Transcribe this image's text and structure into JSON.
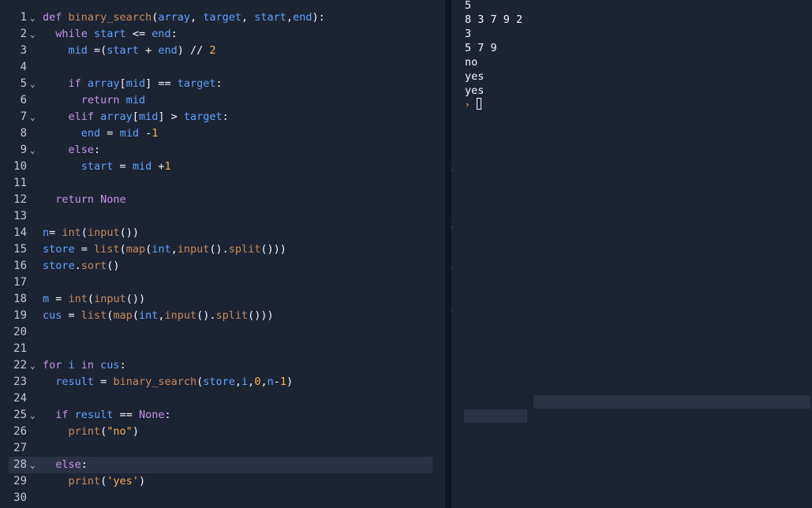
{
  "editor": {
    "active_line": 28,
    "lines": [
      {
        "n": "1",
        "fold": true,
        "tokens": [
          [
            "kw",
            "def "
          ],
          [
            "fn",
            "binary_search"
          ],
          [
            "op",
            "("
          ],
          [
            "var",
            "array"
          ],
          [
            "op",
            ", "
          ],
          [
            "var",
            "target"
          ],
          [
            "op",
            ", "
          ],
          [
            "var",
            "start"
          ],
          [
            "op",
            ","
          ],
          [
            "var",
            "end"
          ],
          [
            "op",
            "):"
          ]
        ]
      },
      {
        "n": "2",
        "fold": true,
        "tokens": [
          [
            "op",
            "  "
          ],
          [
            "kw",
            "while "
          ],
          [
            "var",
            "start"
          ],
          [
            "op",
            " <= "
          ],
          [
            "var",
            "end"
          ],
          [
            "op",
            ":"
          ]
        ]
      },
      {
        "n": "3",
        "fold": false,
        "tokens": [
          [
            "op",
            "    "
          ],
          [
            "var",
            "mid"
          ],
          [
            "op",
            " =("
          ],
          [
            "var",
            "start"
          ],
          [
            "op",
            " + "
          ],
          [
            "var",
            "end"
          ],
          [
            "op",
            ") // "
          ],
          [
            "num",
            "2"
          ]
        ]
      },
      {
        "n": "4",
        "fold": false,
        "tokens": []
      },
      {
        "n": "5",
        "fold": true,
        "tokens": [
          [
            "op",
            "    "
          ],
          [
            "kw",
            "if "
          ],
          [
            "var",
            "array"
          ],
          [
            "op",
            "["
          ],
          [
            "var",
            "mid"
          ],
          [
            "op",
            "] == "
          ],
          [
            "var",
            "target"
          ],
          [
            "op",
            ":"
          ]
        ]
      },
      {
        "n": "6",
        "fold": false,
        "tokens": [
          [
            "op",
            "      "
          ],
          [
            "kw",
            "return "
          ],
          [
            "var",
            "mid"
          ]
        ]
      },
      {
        "n": "7",
        "fold": true,
        "tokens": [
          [
            "op",
            "    "
          ],
          [
            "kw",
            "elif "
          ],
          [
            "var",
            "array"
          ],
          [
            "op",
            "["
          ],
          [
            "var",
            "mid"
          ],
          [
            "op",
            "] > "
          ],
          [
            "var",
            "target"
          ],
          [
            "op",
            ":"
          ]
        ]
      },
      {
        "n": "8",
        "fold": false,
        "tokens": [
          [
            "op",
            "      "
          ],
          [
            "var",
            "end"
          ],
          [
            "op",
            " = "
          ],
          [
            "var",
            "mid"
          ],
          [
            "op",
            " -"
          ],
          [
            "num",
            "1"
          ]
        ]
      },
      {
        "n": "9",
        "fold": true,
        "tokens": [
          [
            "op",
            "    "
          ],
          [
            "kw",
            "else"
          ],
          [
            "op",
            ":"
          ]
        ]
      },
      {
        "n": "10",
        "fold": false,
        "tokens": [
          [
            "op",
            "      "
          ],
          [
            "var",
            "start"
          ],
          [
            "op",
            " = "
          ],
          [
            "var",
            "mid"
          ],
          [
            "op",
            " +"
          ],
          [
            "num",
            "1"
          ]
        ]
      },
      {
        "n": "11",
        "fold": false,
        "tokens": []
      },
      {
        "n": "12",
        "fold": false,
        "tokens": [
          [
            "op",
            "  "
          ],
          [
            "kw",
            "return "
          ],
          [
            "kw",
            "None"
          ]
        ]
      },
      {
        "n": "13",
        "fold": false,
        "tokens": []
      },
      {
        "n": "14",
        "fold": false,
        "tokens": [
          [
            "var",
            "n"
          ],
          [
            "op",
            "= "
          ],
          [
            "fn",
            "int"
          ],
          [
            "op",
            "("
          ],
          [
            "fn",
            "input"
          ],
          [
            "op",
            "())"
          ]
        ]
      },
      {
        "n": "15",
        "fold": false,
        "tokens": [
          [
            "var",
            "store"
          ],
          [
            "op",
            " = "
          ],
          [
            "fn",
            "list"
          ],
          [
            "op",
            "("
          ],
          [
            "fn",
            "map"
          ],
          [
            "op",
            "("
          ],
          [
            "var",
            "int"
          ],
          [
            "op",
            ","
          ],
          [
            "fn",
            "input"
          ],
          [
            "op",
            "()."
          ],
          [
            "fn",
            "split"
          ],
          [
            "op",
            "()))"
          ]
        ]
      },
      {
        "n": "16",
        "fold": false,
        "tokens": [
          [
            "var",
            "store"
          ],
          [
            "op",
            "."
          ],
          [
            "fn",
            "sort"
          ],
          [
            "op",
            "()"
          ]
        ]
      },
      {
        "n": "17",
        "fold": false,
        "tokens": []
      },
      {
        "n": "18",
        "fold": false,
        "tokens": [
          [
            "var",
            "m"
          ],
          [
            "op",
            " = "
          ],
          [
            "fn",
            "int"
          ],
          [
            "op",
            "("
          ],
          [
            "fn",
            "input"
          ],
          [
            "op",
            "())"
          ]
        ]
      },
      {
        "n": "19",
        "fold": false,
        "tokens": [
          [
            "var",
            "cus"
          ],
          [
            "op",
            " = "
          ],
          [
            "fn",
            "list"
          ],
          [
            "op",
            "("
          ],
          [
            "fn",
            "map"
          ],
          [
            "op",
            "("
          ],
          [
            "var",
            "int"
          ],
          [
            "op",
            ","
          ],
          [
            "fn",
            "input"
          ],
          [
            "op",
            "()."
          ],
          [
            "fn",
            "split"
          ],
          [
            "op",
            "()))"
          ]
        ]
      },
      {
        "n": "20",
        "fold": false,
        "tokens": []
      },
      {
        "n": "21",
        "fold": false,
        "tokens": []
      },
      {
        "n": "22",
        "fold": true,
        "tokens": [
          [
            "kw",
            "for "
          ],
          [
            "var",
            "i"
          ],
          [
            "kw",
            " in "
          ],
          [
            "var",
            "cus"
          ],
          [
            "op",
            ":"
          ]
        ]
      },
      {
        "n": "23",
        "fold": false,
        "tokens": [
          [
            "op",
            "  "
          ],
          [
            "var",
            "result"
          ],
          [
            "op",
            " = "
          ],
          [
            "fn",
            "binary_search"
          ],
          [
            "op",
            "("
          ],
          [
            "var",
            "store"
          ],
          [
            "op",
            ","
          ],
          [
            "var",
            "i"
          ],
          [
            "op",
            ","
          ],
          [
            "num",
            "0"
          ],
          [
            "op",
            ","
          ],
          [
            "var",
            "n"
          ],
          [
            "op",
            "-"
          ],
          [
            "num",
            "1"
          ],
          [
            "op",
            ")"
          ]
        ]
      },
      {
        "n": "24",
        "fold": false,
        "tokens": []
      },
      {
        "n": "25",
        "fold": true,
        "tokens": [
          [
            "op",
            "  "
          ],
          [
            "kw",
            "if "
          ],
          [
            "var",
            "result"
          ],
          [
            "op",
            " == "
          ],
          [
            "kw",
            "None"
          ],
          [
            "op",
            ":"
          ]
        ]
      },
      {
        "n": "26",
        "fold": false,
        "tokens": [
          [
            "op",
            "    "
          ],
          [
            "fn",
            "print"
          ],
          [
            "op",
            "("
          ],
          [
            "str",
            "\"no\""
          ],
          [
            "op",
            ")"
          ]
        ]
      },
      {
        "n": "27",
        "fold": false,
        "tokens": []
      },
      {
        "n": "28",
        "fold": true,
        "tokens": [
          [
            "op",
            "  "
          ],
          [
            "kw",
            "else"
          ],
          [
            "op",
            ":"
          ]
        ]
      },
      {
        "n": "29",
        "fold": false,
        "tokens": [
          [
            "op",
            "    "
          ],
          [
            "fn",
            "print"
          ],
          [
            "op",
            "("
          ],
          [
            "str",
            "'yes'"
          ],
          [
            "op",
            ")"
          ]
        ]
      },
      {
        "n": "30",
        "fold": false,
        "tokens": []
      }
    ]
  },
  "icons": {
    "fold": "chevron-down-icon",
    "prompt": "chevron-right-icon"
  },
  "console": {
    "lines": [
      "5",
      "8 3 7 9 2",
      "3",
      "5 7 9",
      "no",
      "yes",
      "yes"
    ],
    "prompt_glyph": "›"
  },
  "colors": {
    "editor_bg": "#1c2333",
    "divider": "#0e1525",
    "keyword": "#c792ea",
    "function": "#c78b5e",
    "variable": "#62a3ff",
    "number_string": "#f2b24c",
    "text": "#f5f9fc",
    "active_line": "#2b3245"
  }
}
